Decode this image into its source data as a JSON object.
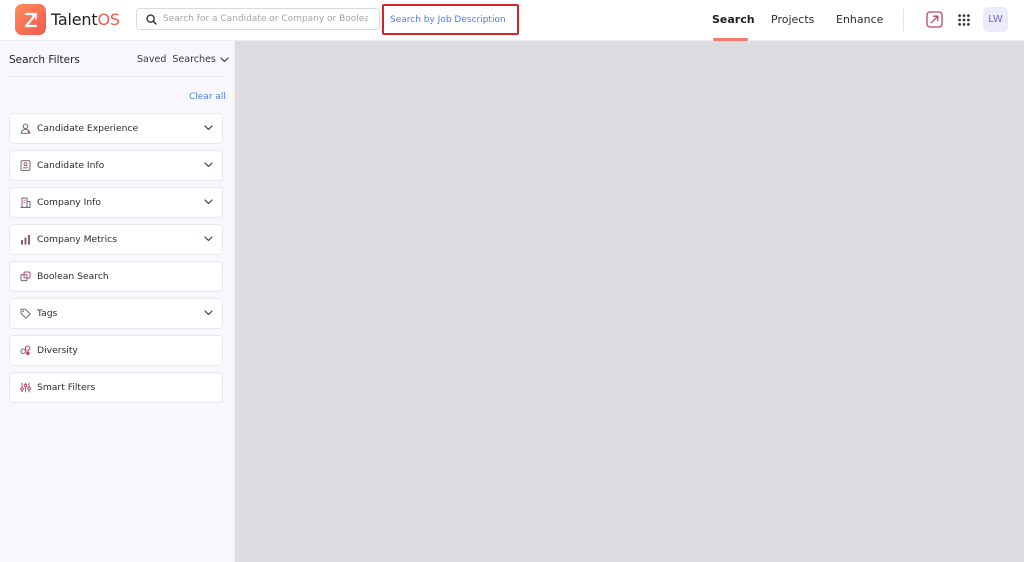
{
  "header": {
    "logo": {
      "text_main": "Talent",
      "text_accent": "OS"
    },
    "search": {
      "placeholder": "Search for a Candidate or Company or Boolean"
    },
    "jd_search_label": "Search by Job Description",
    "nav": [
      {
        "label": "Search",
        "active": true
      },
      {
        "label": "Projects",
        "active": false
      },
      {
        "label": "Enhance",
        "active": false
      }
    ],
    "avatar_initials": "LW"
  },
  "sidebar": {
    "title": "Search Filters",
    "saved_searches_label": "Saved  Searches",
    "clear_all_label": "Clear all",
    "filters": [
      {
        "label": "Candidate Experience",
        "icon": "person-icon",
        "expandable": true
      },
      {
        "label": "Candidate Info",
        "icon": "id-card-icon",
        "expandable": true
      },
      {
        "label": "Company Info",
        "icon": "building-icon",
        "expandable": true
      },
      {
        "label": "Company Metrics",
        "icon": "bar-chart-icon",
        "expandable": true
      },
      {
        "label": "Boolean Search",
        "icon": "boolean-icon",
        "expandable": false
      },
      {
        "label": "Tags",
        "icon": "tag-icon",
        "expandable": true
      },
      {
        "label": "Diversity",
        "icon": "diversity-icon",
        "expandable": false
      },
      {
        "label": "Smart Filters",
        "icon": "sliders-icon",
        "expandable": false
      }
    ]
  },
  "colors": {
    "accent": "#f25a4a",
    "link": "#4a7ee8",
    "highlight_border": "#d1242c",
    "main_bg": "#dddce0"
  }
}
